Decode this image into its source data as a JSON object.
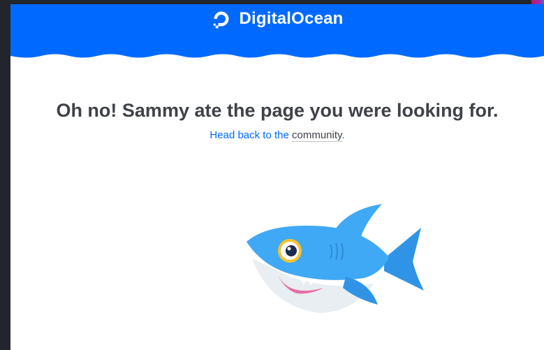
{
  "header": {
    "brand_name": "DigitalOcean",
    "logo_icon": "digitalocean-logo-icon",
    "background_color": "#0069ff"
  },
  "error": {
    "headline": "Oh no! Sammy ate the page you were looking for.",
    "back_prefix": "Head back to the ",
    "back_link_label": "community",
    "back_suffix": ".",
    "link_color": "#0069ff",
    "headline_color": "#3f4247"
  },
  "mascot": {
    "icon": "sammy-shark-icon",
    "color": "#3fa9f5"
  }
}
